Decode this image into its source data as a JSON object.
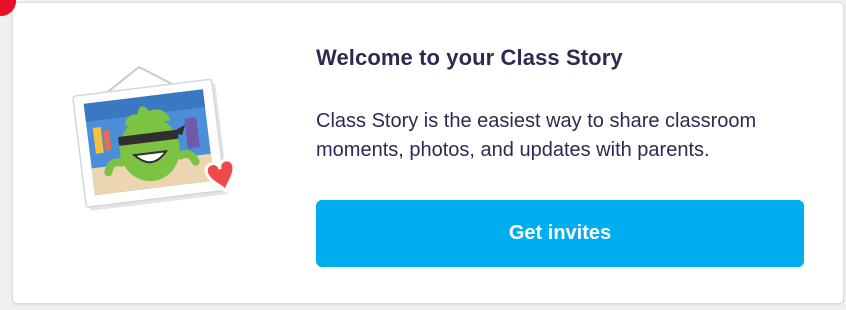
{
  "card": {
    "title": "Welcome to your Class Story",
    "description": "Class Story is the easiest way to share classroom moments, photos, and updates with parents.",
    "button_label": "Get invites"
  },
  "illustration": {
    "icon": "framed-monster-photo-with-heart-icon"
  },
  "colors": {
    "button": "#00aeef",
    "text": "#2c2a50",
    "monster": "#7cc243",
    "heart": "#ef4a4a"
  }
}
